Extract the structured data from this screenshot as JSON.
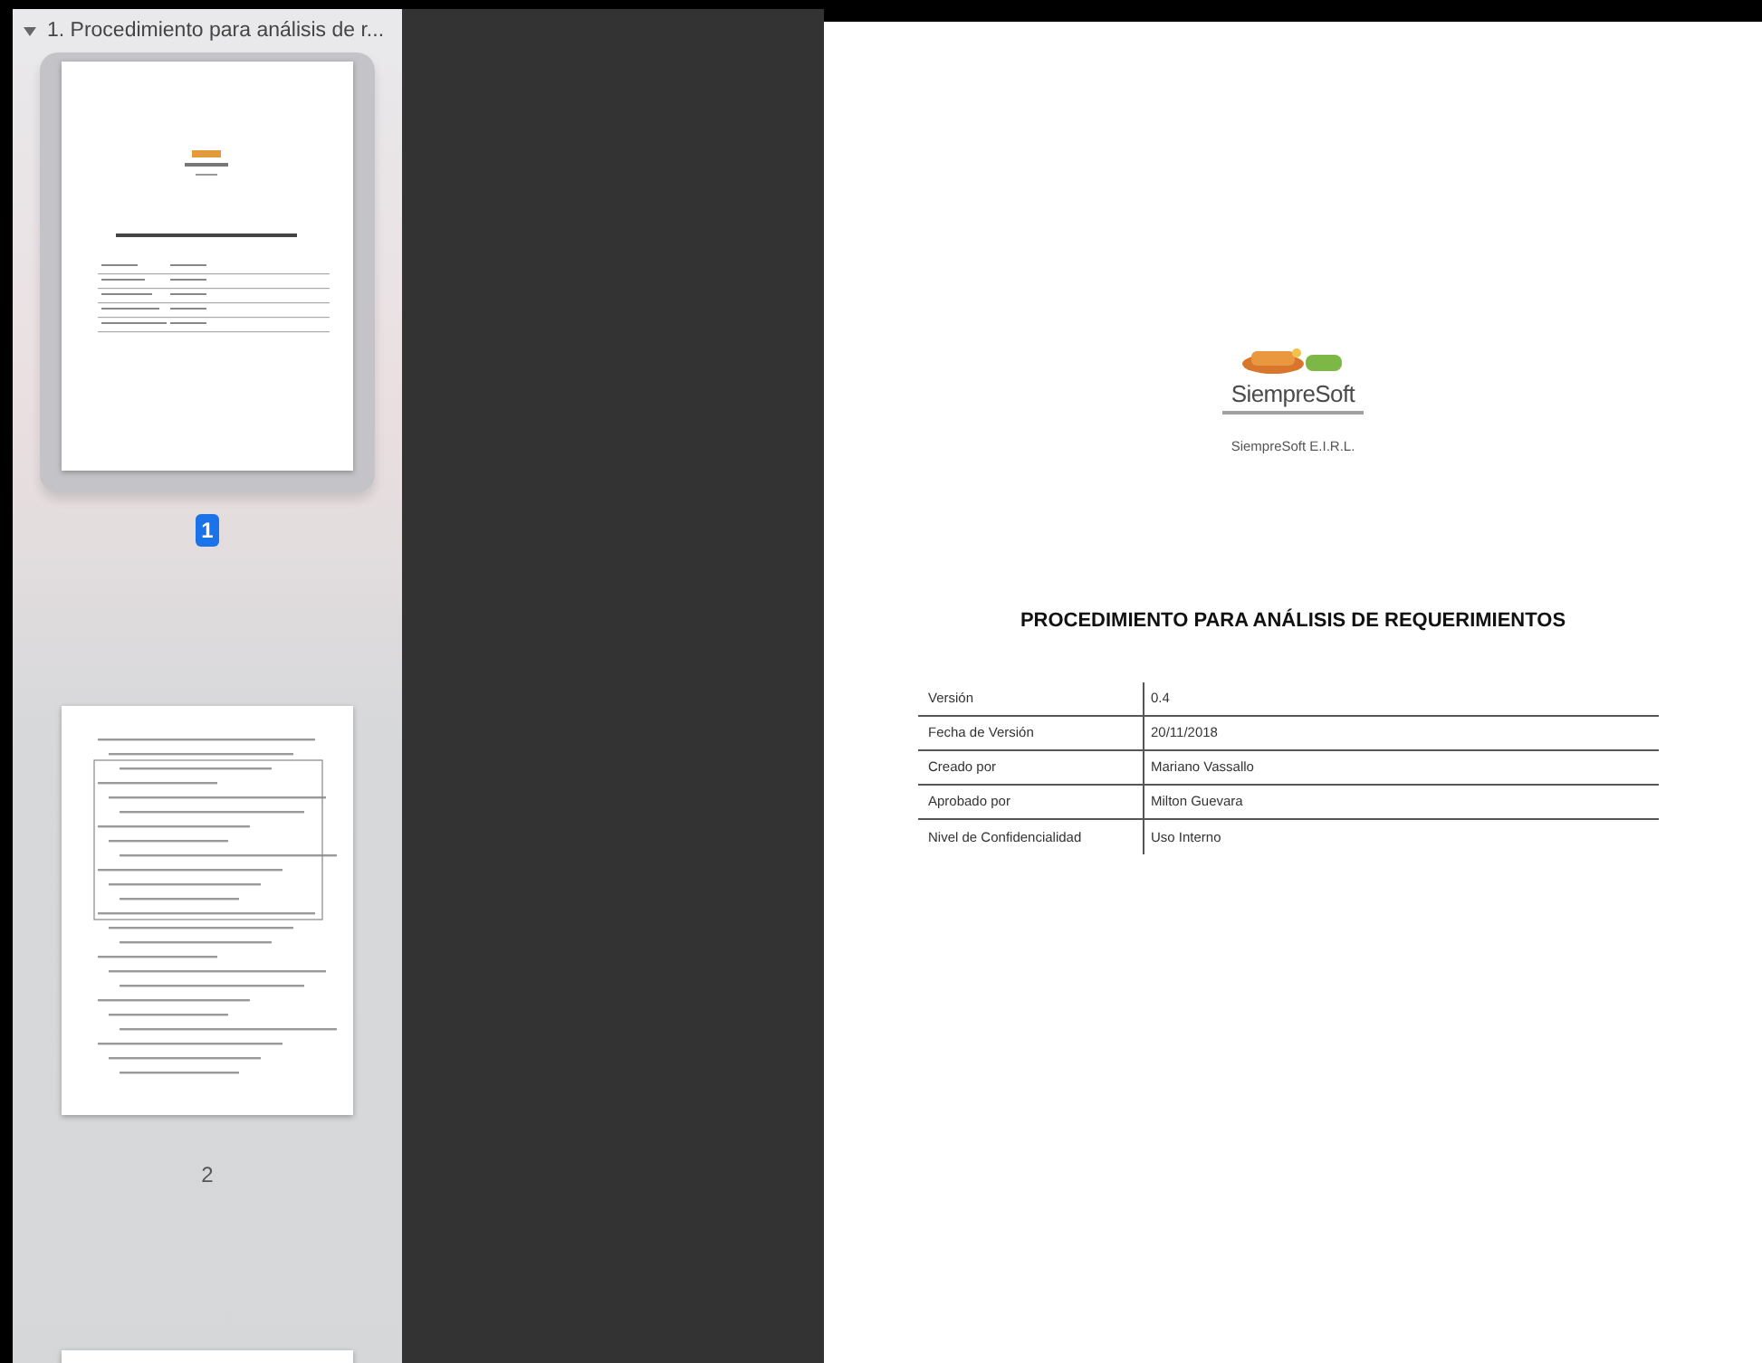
{
  "sidebar": {
    "outline_title": "1. Procedimiento para análisis de r...",
    "expanded": true,
    "thumbnails": [
      {
        "label": "1",
        "selected": true
      },
      {
        "label": "2",
        "selected": false
      },
      {
        "selected": false
      }
    ]
  },
  "page": {
    "company": "SiempreSoft",
    "company_legal": "SiempreSoft E.I.R.L.",
    "title": "PROCEDIMIENTO PARA ANÁLISIS DE REQUERIMIENTOS",
    "fields": [
      {
        "label": "Versión",
        "value": "0.4"
      },
      {
        "label": "Fecha de Versión",
        "value": "20/11/2018"
      },
      {
        "label": "Creado por",
        "value": "Mariano Vassallo"
      },
      {
        "label": "Aprobado por",
        "value": "Milton Guevara"
      },
      {
        "label": "Nivel de Confidencialidad",
        "value": "Uso Interno"
      }
    ]
  }
}
